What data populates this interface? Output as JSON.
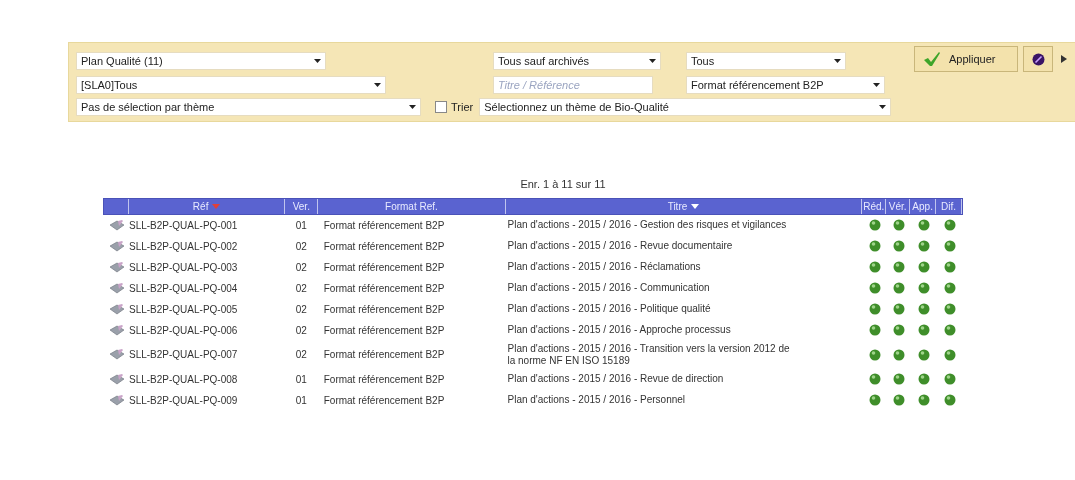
{
  "filters": {
    "row_1": [
      {
        "kind": "select",
        "value": "Plan Qualité (11)"
      },
      {
        "kind": "select",
        "value": "Tous sauf archivés"
      },
      {
        "kind": "select",
        "value": "Tous"
      }
    ],
    "row_2": [
      {
        "kind": "select",
        "value": "[SLA0]Tous"
      },
      {
        "kind": "input",
        "placeholder": "Titre / Référence"
      },
      {
        "kind": "select",
        "value": "Format référencement B2P"
      }
    ],
    "row_3": [
      {
        "kind": "select",
        "value": "Pas de sélection par thème"
      },
      {
        "kind": "checkbox",
        "label": "Trier",
        "checked": false
      },
      {
        "kind": "select",
        "value": "Sélectionnez un thème de Bio-Qualité"
      }
    ],
    "apply_button": "Appliquer"
  },
  "pager": "Enr. 1 à 11 sur 11",
  "table": {
    "columns": [
      {
        "label": "Réf",
        "sorted": true,
        "color": "#e0403a"
      },
      {
        "label": "Ver.",
        "sorted": false
      },
      {
        "label": "Format Ref.",
        "sorted": false
      },
      {
        "label": "Titre",
        "sorted": true,
        "color": "#ffffff"
      },
      {
        "label": "Réd.",
        "sorted": false
      },
      {
        "label": "Vér.",
        "sorted": false
      },
      {
        "label": "App.",
        "sorted": false
      },
      {
        "label": "Dif.",
        "sorted": false
      }
    ],
    "rows": [
      {
        "ref": "SLL-B2P-QUAL-PQ-001",
        "ver": "01",
        "format": "Format référencement B2P",
        "title": "Plan d'actions - 2015 / 2016 - Gestion des risques et vigilances"
      },
      {
        "ref": "SLL-B2P-QUAL-PQ-002",
        "ver": "02",
        "format": "Format référencement B2P",
        "title": "Plan d'actions - 2015 / 2016 - Revue documentaire"
      },
      {
        "ref": "SLL-B2P-QUAL-PQ-003",
        "ver": "02",
        "format": "Format référencement B2P",
        "title": "Plan d'actions - 2015 / 2016 - Réclamations"
      },
      {
        "ref": "SLL-B2P-QUAL-PQ-004",
        "ver": "02",
        "format": "Format référencement B2P",
        "title": "Plan d'actions - 2015 / 2016 - Communication"
      },
      {
        "ref": "SLL-B2P-QUAL-PQ-005",
        "ver": "02",
        "format": "Format référencement B2P",
        "title": "Plan d'actions - 2015 / 2016 - Politique qualité"
      },
      {
        "ref": "SLL-B2P-QUAL-PQ-006",
        "ver": "02",
        "format": "Format référencement B2P",
        "title": "Plan d'actions - 2015 / 2016 - Approche processus"
      },
      {
        "ref": "SLL-B2P-QUAL-PQ-007",
        "ver": "02",
        "format": "Format référencement B2P",
        "title": "Plan d'actions - 2015 / 2016 - Transition vers la version 2012 de la norme NF EN ISO 15189"
      },
      {
        "ref": "SLL-B2P-QUAL-PQ-008",
        "ver": "01",
        "format": "Format référencement B2P",
        "title": "Plan d'actions - 2015 / 2016 - Revue de direction"
      },
      {
        "ref": "SLL-B2P-QUAL-PQ-009",
        "ver": "01",
        "format": "Format référencement B2P",
        "title": "Plan d'actions - 2015 / 2016 - Personnel"
      }
    ]
  }
}
